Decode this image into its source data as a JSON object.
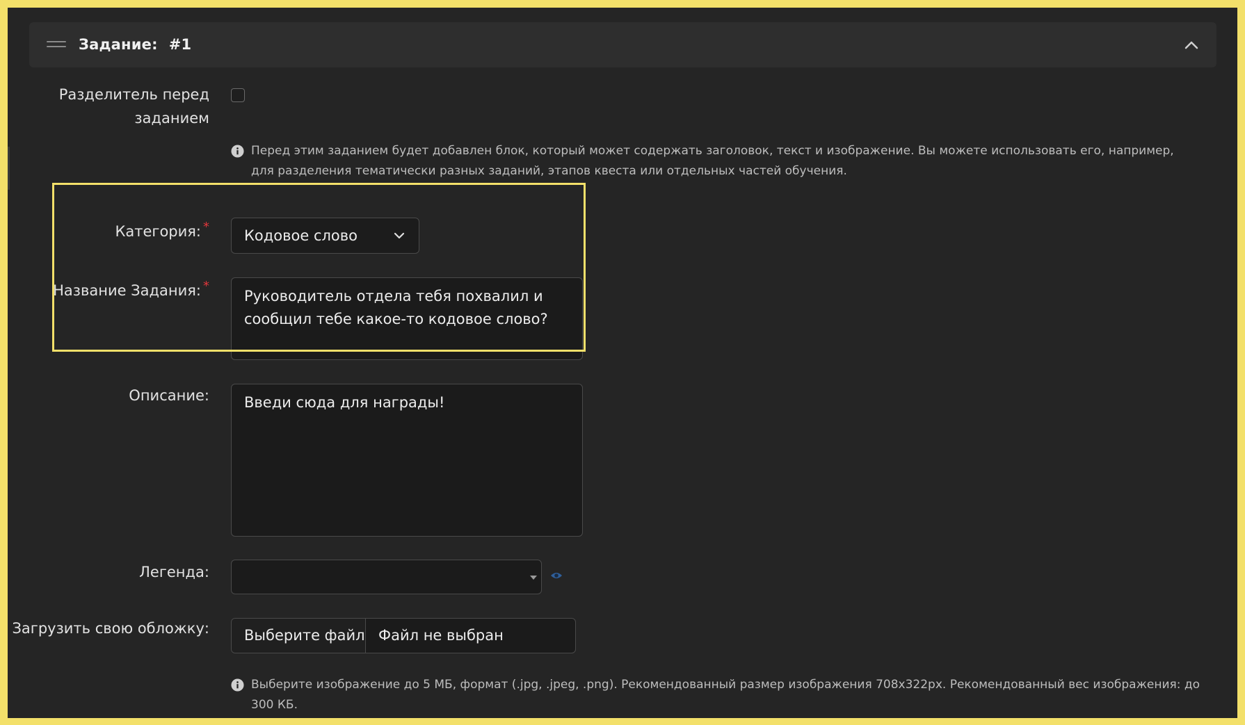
{
  "header": {
    "title": "Задание:",
    "number": "#1"
  },
  "separator": {
    "label": "Разделитель перед заданием",
    "checked": false,
    "hint": "Перед этим заданием будет добавлен блок, который может содержать заголовок, текст и изображение. Вы можете использовать его, например, для разделения тематически разных заданий, этапов квеста или отдельных частей обучения."
  },
  "category": {
    "label": "Категория:",
    "required_mark": "*",
    "value": "Кодовое слово"
  },
  "task_name": {
    "label": "Название Задания:",
    "required_mark": "*",
    "value": "Руководитель отдела тебя похвалил и сообщил тебе какое-то кодовое слово?"
  },
  "description": {
    "label": "Описание:",
    "value": "Введи сюда для награды!"
  },
  "legend": {
    "label": "Легенда:",
    "value": ""
  },
  "cover": {
    "label": "Загрузить свою обложку:",
    "button_label": "Выберите файл",
    "status": "Файл не выбран",
    "hint": "Выберите изображение до 5 МБ, формат (.jpg, .jpeg, .png). Рекомендованный размер изображения 708x322px. Рекомендованный вес изображения: до 300 КБ."
  },
  "colors": {
    "frame": "#f3e06a",
    "panel_bg": "#252525",
    "header_bg": "#2e2e2e",
    "required": "#e0363b",
    "eye_icon": "#2f5f9a"
  }
}
